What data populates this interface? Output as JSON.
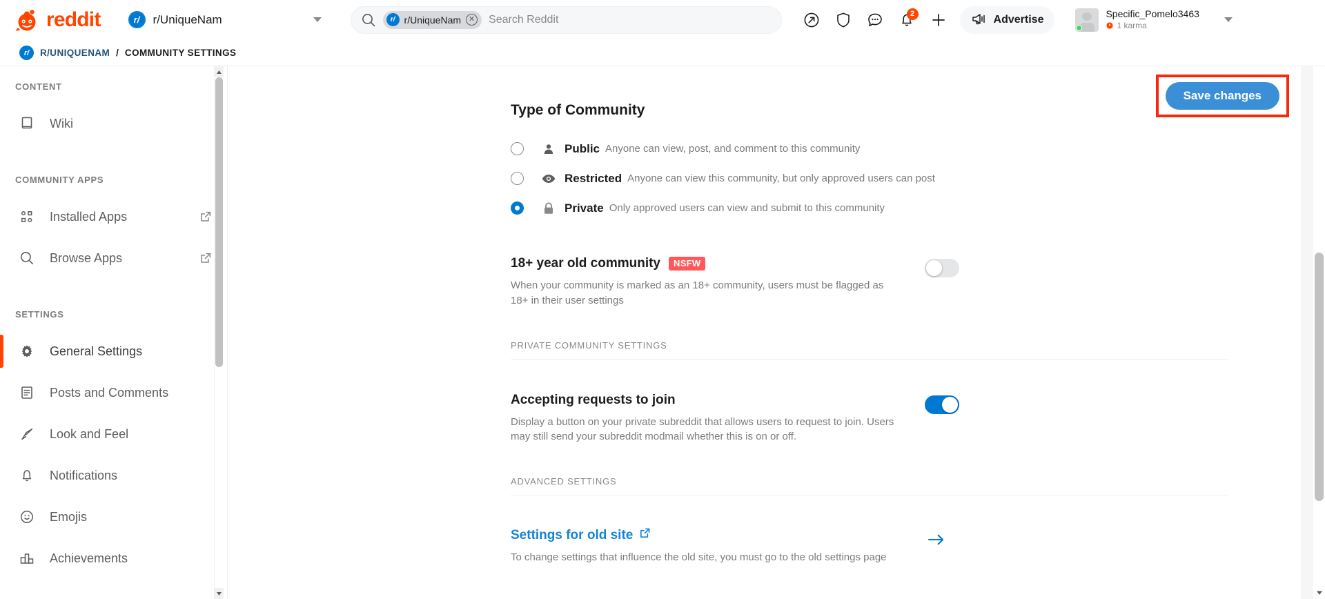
{
  "topnav": {
    "logo_text": "reddit",
    "logo_icon": "reddit-snoo-icon",
    "subreddit_switcher": {
      "avatar_glyph": "r/",
      "name": "r/UniqueNam",
      "chevron_icon": "chevron-down-icon"
    },
    "search": {
      "search_icon": "search-icon",
      "chip_avatar_glyph": "r/",
      "chip_label": "r/UniqueNam",
      "chip_remove_icon": "close-circle-icon",
      "placeholder": "Search Reddit",
      "value": ""
    },
    "icons": [
      {
        "name": "popular-icon",
        "label": "Popular"
      },
      {
        "name": "shield-icon",
        "label": "Mod"
      },
      {
        "name": "chat-icon",
        "label": "Chat"
      },
      {
        "name": "notifications-bell-icon",
        "label": "Notifications",
        "badge": "2"
      },
      {
        "name": "create-post-plus-icon",
        "label": "Create"
      }
    ],
    "advertise": {
      "label": "Advertise",
      "icon": "megaphone-icon"
    },
    "user": {
      "name": "Specific_Pomelo3463",
      "karma": "1 karma",
      "karma_icon": "karma-icon",
      "avatar_icon": "user-avatar",
      "status": "online",
      "chevron_icon": "chevron-down-icon"
    }
  },
  "breadcrumb": {
    "avatar_glyph": "r/",
    "subreddit": "R/UNIQUENAM",
    "separator": "/",
    "current": "COMMUNITY SETTINGS"
  },
  "sidebar": {
    "sections": [
      {
        "heading": "CONTENT",
        "items": [
          {
            "label": "Wiki",
            "icon": "book-icon",
            "external": false,
            "active": false
          }
        ]
      },
      {
        "heading": "COMMUNITY APPS",
        "items": [
          {
            "label": "Installed Apps",
            "icon": "apps-grid-icon",
            "external": true,
            "active": false
          },
          {
            "label": "Browse Apps",
            "icon": "search-icon",
            "external": true,
            "active": false
          }
        ]
      },
      {
        "heading": "SETTINGS",
        "items": [
          {
            "label": "General Settings",
            "icon": "gear-icon",
            "external": false,
            "active": true
          },
          {
            "label": "Posts and Comments",
            "icon": "document-lines-icon",
            "external": false,
            "active": false
          },
          {
            "label": "Look and Feel",
            "icon": "paintbrush-icon",
            "external": false,
            "active": false
          },
          {
            "label": "Notifications",
            "icon": "bell-icon",
            "external": false,
            "active": false
          },
          {
            "label": "Emojis",
            "icon": "smiley-face-icon",
            "external": false,
            "active": false
          },
          {
            "label": "Achievements",
            "icon": "podium-icon",
            "external": false,
            "active": false
          }
        ]
      }
    ],
    "scrollbar": {
      "up_icon": "caret-up-icon",
      "down_icon": "caret-down-icon"
    }
  },
  "main": {
    "save_button": {
      "label": "Save changes",
      "highlighted": true,
      "highlight_color": "#f4290e",
      "button_color": "#3a8fd6"
    },
    "community_type": {
      "title": "Type of Community",
      "selected": "Private",
      "options": [
        {
          "name": "Public",
          "icon": "person-icon",
          "description": "Anyone can view, post, and comment to this community",
          "selected": false
        },
        {
          "name": "Restricted",
          "icon": "eye-icon",
          "description": "Anyone can view this community, but only approved users can post",
          "selected": false
        },
        {
          "name": "Private",
          "icon": "lock-icon",
          "description": "Only approved users can view and submit to this community",
          "selected": true
        }
      ]
    },
    "nsfw": {
      "title": "18+ year old community",
      "badge": "NSFW",
      "badge_color": "#ff585b",
      "description": "When your community is marked as an 18+ community, users must be flagged as 18+ in their user settings",
      "toggle_on": false
    },
    "private_section_label": "PRIVATE COMMUNITY SETTINGS",
    "accepting_requests": {
      "title": "Accepting requests to join",
      "description": "Display a button on your private subreddit that allows users to request to join. Users may still send your subreddit modmail whether this is on or off.",
      "toggle_on": true
    },
    "advanced_section_label": "ADVANCED SETTINGS",
    "old_site": {
      "title": "Settings for old site",
      "external_icon": "external-link-icon",
      "description": "To change settings that influence the old site, you must go to the old settings page",
      "arrow_icon": "arrow-right-icon"
    },
    "scrollbar": {
      "down_icon": "caret-down-icon"
    }
  }
}
